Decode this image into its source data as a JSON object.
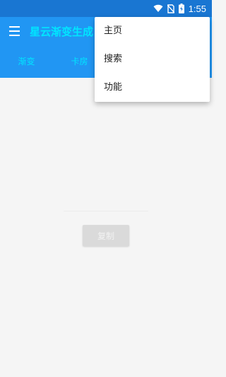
{
  "status_bar": {
    "time": "1:55",
    "icons": [
      "wifi-icon",
      "no-sim-icon",
      "battery-charging-icon"
    ]
  },
  "app_bar": {
    "title": "星云渐变生成",
    "menu_icon": "hamburger-menu-icon"
  },
  "tabs": [
    {
      "label": "渐变"
    },
    {
      "label": "卡房"
    }
  ],
  "main": {
    "copy_label": "复制"
  },
  "popup_menu": {
    "items": [
      {
        "label": "主页"
      },
      {
        "label": "搜索"
      },
      {
        "label": "功能"
      }
    ]
  },
  "colors": {
    "status_bar": "#1976d2",
    "app_bar": "#2196f3",
    "accent_text": "#00e5ff",
    "background": "#f5f5f5"
  }
}
